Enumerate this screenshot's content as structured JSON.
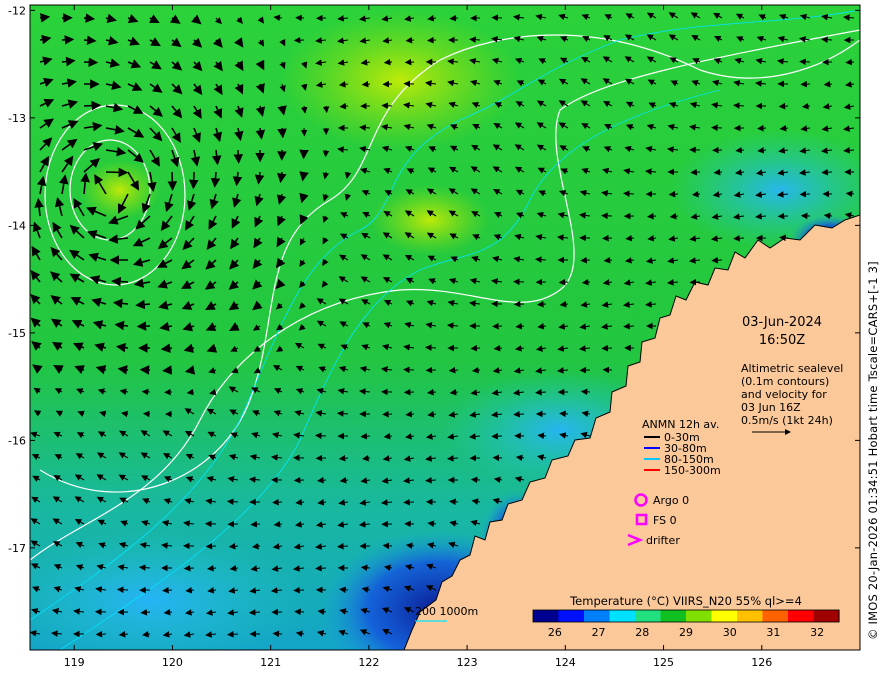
{
  "map": {
    "lon_ticks": [
      "119",
      "120",
      "121",
      "122",
      "123",
      "124",
      "125",
      "126"
    ],
    "lat_ticks": [
      "-12",
      "-13",
      "-14",
      "-15",
      "-16",
      "-17"
    ],
    "lon_range": [
      118.55,
      127.0
    ],
    "lat_range": [
      -17.95,
      -11.95
    ]
  },
  "timestamp": {
    "date": "03-Jun-2024",
    "time": "16:50Z"
  },
  "altimetry_note": [
    "Altimetric sealevel",
    "(0.1m contours)",
    "and velocity for",
    "03 Jun 16Z",
    "0.5m/s (1kt 24h)"
  ],
  "anmn": {
    "title": "ANMN 12h av.",
    "items": [
      {
        "label": "0-30m",
        "color": "#000000"
      },
      {
        "label": "30-80m",
        "color": "#0000ff"
      },
      {
        "label": "80-150m",
        "color": "#00c8ff"
      },
      {
        "label": "150-300m",
        "color": "#ff0000"
      }
    ]
  },
  "markers": {
    "argo": "Argo 0",
    "fs": "FS 0",
    "drifter": "drifter",
    "color": "#ff00ff"
  },
  "depth_legend": {
    "label": "200  1000m",
    "color": "#00e5ff"
  },
  "colorbar": {
    "title": "Temperature (°C) VIIRS_N20 55% ql>=4",
    "ticks": [
      "26",
      "27",
      "28",
      "29",
      "30",
      "31",
      "32"
    ],
    "range": [
      25.5,
      32.5
    ],
    "colors": [
      "#00008f",
      "#0010ff",
      "#0080ff",
      "#00e0ff",
      "#20e080",
      "#10c020",
      "#80e000",
      "#ffff00",
      "#ffc000",
      "#ff6000",
      "#ff0000",
      "#a00000"
    ]
  },
  "caption": "© IMOS 20-Jan-2026 01:34:51 Hobart time Tscale=CARS+[-1 3]",
  "colors": {
    "land": "#fbc89a",
    "ocean_warm": "#22c83c",
    "ocean_cool": "#1eb4a0",
    "deep_blue": "#0a1890"
  }
}
